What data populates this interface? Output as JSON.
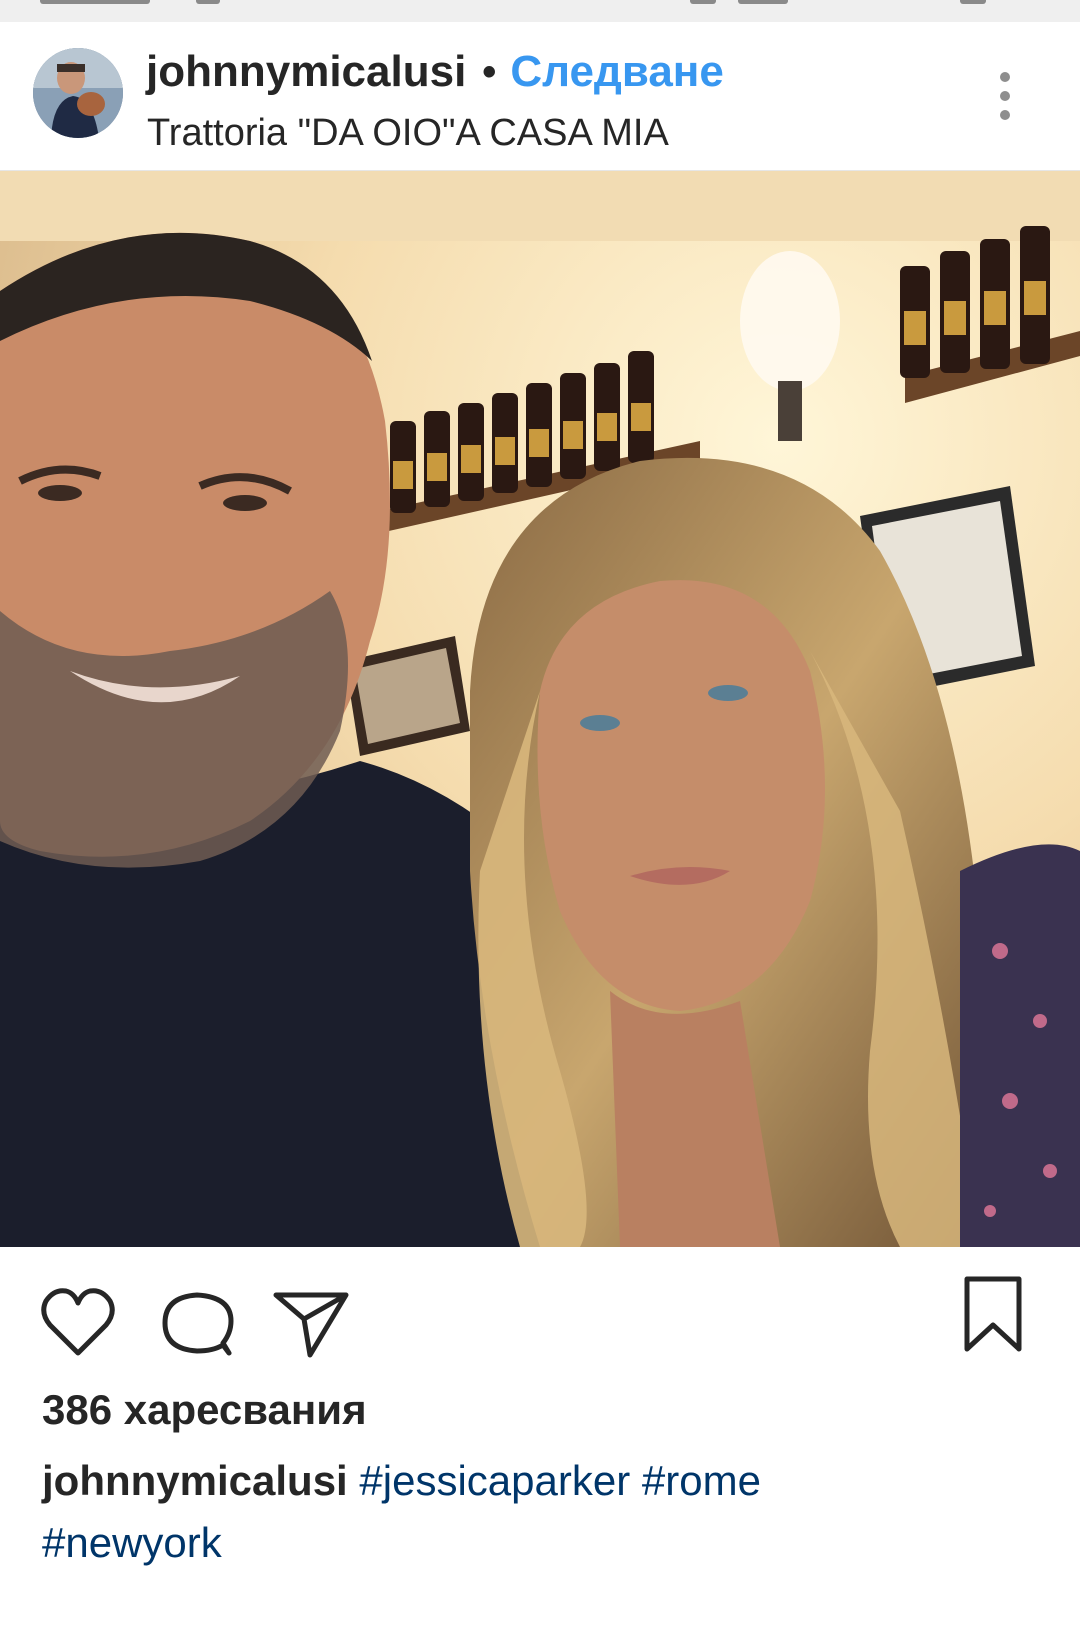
{
  "post": {
    "username": "johnnymicalusi",
    "separator": "•",
    "follow_label": "Следване",
    "location": "Trattoria \"DA OIO\"A CASA MIA",
    "more_icon": "more-vertical-icon"
  },
  "actions": {
    "like_icon": "heart-icon",
    "comment_icon": "comment-icon",
    "share_icon": "send-icon",
    "save_icon": "bookmark-icon"
  },
  "likes_text": "386 харесвания",
  "caption": {
    "username": "johnnymicalusi",
    "tags": [
      "#jessicaparker",
      "#rome",
      "#newyork"
    ]
  },
  "colors": {
    "link_blue": "#3897f0",
    "hashtag_blue": "#003569",
    "text": "#262626",
    "icon": "#262626"
  }
}
